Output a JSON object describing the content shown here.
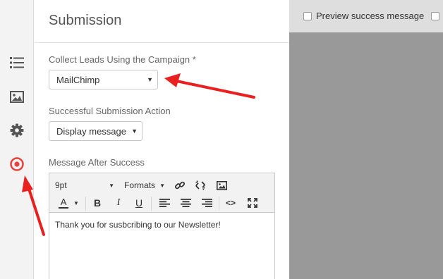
{
  "panel": {
    "title": "Submission"
  },
  "lead_campaign": {
    "label": "Collect Leads Using the Campaign *",
    "value": "MailChimp"
  },
  "success_action": {
    "label": "Successful Submission Action",
    "value": "Display message"
  },
  "message": {
    "label": "Message After Success",
    "font_size": "9pt",
    "formats_label": "Formats",
    "text_color_glyph": "A",
    "bold_glyph": "B",
    "italic_glyph": "I",
    "underline_glyph": "U",
    "code_glyph": "<>",
    "body": "Thank you for susbcribing to our Newsletter!"
  },
  "preview": {
    "label": "Preview success message"
  },
  "sidebar": {
    "items": [
      {
        "icon": "list-icon"
      },
      {
        "icon": "image-icon"
      },
      {
        "icon": "gear-icon"
      },
      {
        "icon": "target-icon",
        "active": true,
        "color": "#e8413c"
      }
    ]
  },
  "colors": {
    "annotation_red": "#e8201f",
    "preview_background": "#999999"
  }
}
